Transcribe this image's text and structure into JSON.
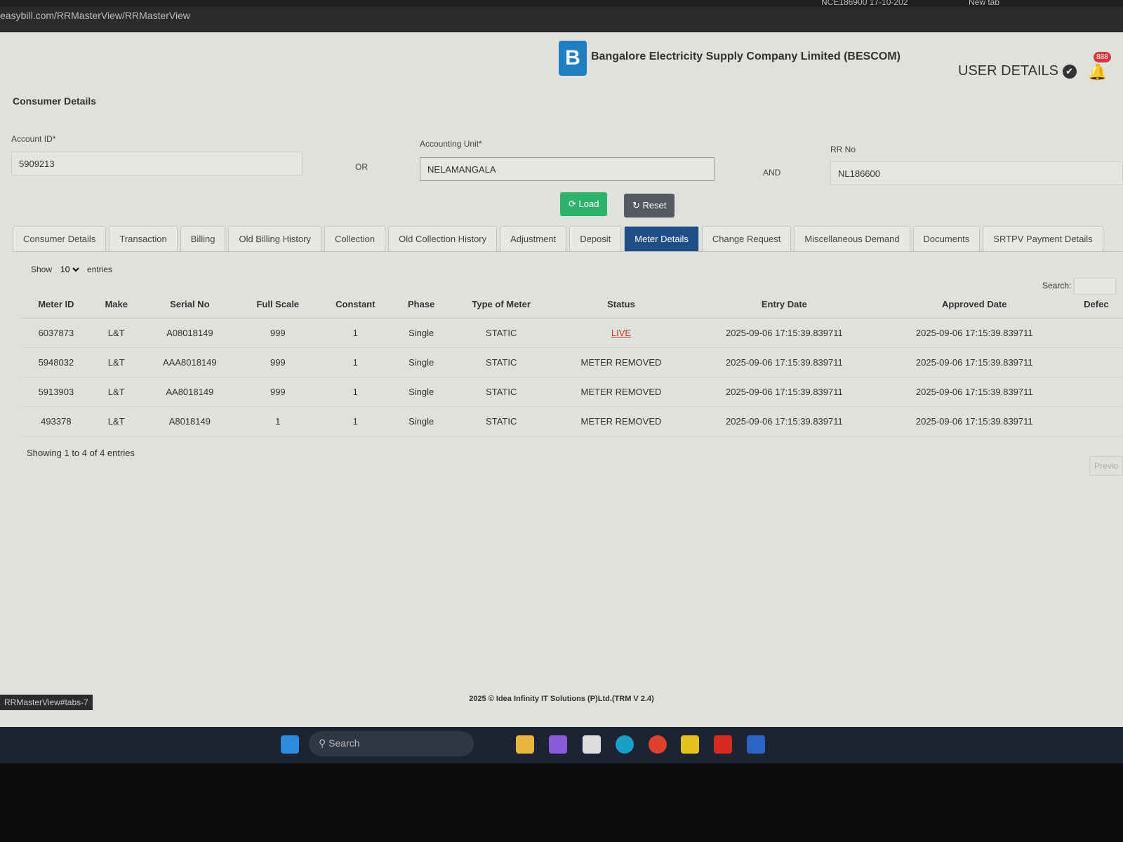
{
  "browser": {
    "tabs": [
      "NCE186900 17-10-202",
      "New tab"
    ],
    "url": "easybill.com/RRMasterView/RRMasterView",
    "status_link": "RRMasterView#tabs-7"
  },
  "header": {
    "company": "Bangalore Electricity Supply Company Limited (BESCOM)",
    "logo_text": "BESCOM",
    "user_details": "USER DETAILS",
    "notification_count": "888"
  },
  "form": {
    "section_title": "Consumer Details",
    "account_id_label": "Account ID*",
    "account_id": "5909213",
    "or": "OR",
    "accounting_unit_label": "Accounting Unit*",
    "accounting_unit": "NELAMANGALA",
    "and": "AND",
    "rr_no_label": "RR No",
    "rr_no": "NL186600",
    "load": "Load",
    "reset": "Reset"
  },
  "tabs": [
    "Consumer Details",
    "Transaction",
    "Billing",
    "Old Billing History",
    "Collection",
    "Old Collection History",
    "Adjustment",
    "Deposit",
    "Meter Details",
    "Change Request",
    "Miscellaneous Demand",
    "Documents",
    "SRTPV Payment Details"
  ],
  "active_tab": "Meter Details",
  "table_controls": {
    "show": "Show",
    "entries_value": "10",
    "entries": "entries",
    "search": "Search:"
  },
  "columns": [
    "Meter ID",
    "Make",
    "Serial No",
    "Full Scale",
    "Constant",
    "Phase",
    "Type of Meter",
    "Status",
    "Entry Date",
    "Approved Date",
    "Defec"
  ],
  "rows": [
    [
      "6037873",
      "L&T",
      "A08018149",
      "999",
      "1",
      "Single",
      "STATIC",
      "LIVE",
      "2025-09-06 17:15:39.839711",
      "2025-09-06 17:15:39.839711",
      ""
    ],
    [
      "5948032",
      "L&T",
      "AAA8018149",
      "999",
      "1",
      "Single",
      "STATIC",
      "METER REMOVED",
      "2025-09-06 17:15:39.839711",
      "2025-09-06 17:15:39.839711",
      ""
    ],
    [
      "5913903",
      "L&T",
      "AA8018149",
      "999",
      "1",
      "Single",
      "STATIC",
      "METER REMOVED",
      "2025-09-06 17:15:39.839711",
      "2025-09-06 17:15:39.839711",
      ""
    ],
    [
      "493378",
      "L&T",
      "A8018149",
      "1",
      "1",
      "Single",
      "STATIC",
      "METER REMOVED",
      "2025-09-06 17:15:39.839711",
      "2025-09-06 17:15:39.839711",
      ""
    ]
  ],
  "table_info": "Showing 1 to 4 of 4 entries",
  "pager_prev": "Previo",
  "footer": "2025 © Idea Infinity IT Solutions (P)Ltd.(TRM V 2.4)",
  "taskbar": {
    "search": "Search"
  }
}
